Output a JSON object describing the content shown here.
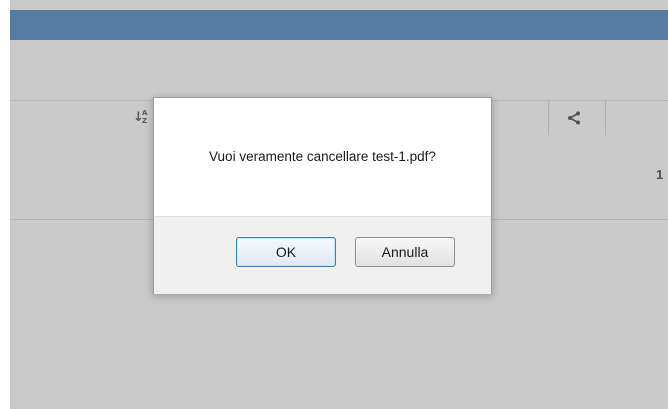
{
  "background": {
    "header_color": "#3b7fbf",
    "table_header": {
      "sort_icon": "sort-alpha-icon",
      "sort_icon_letters": "AZ",
      "share_icon": "share-icon"
    },
    "row_truncated_text": "1"
  },
  "dialog": {
    "message": "Vuoi veramente cancellare test-1.pdf?",
    "ok_label": "OK",
    "cancel_label": "Annulla"
  }
}
